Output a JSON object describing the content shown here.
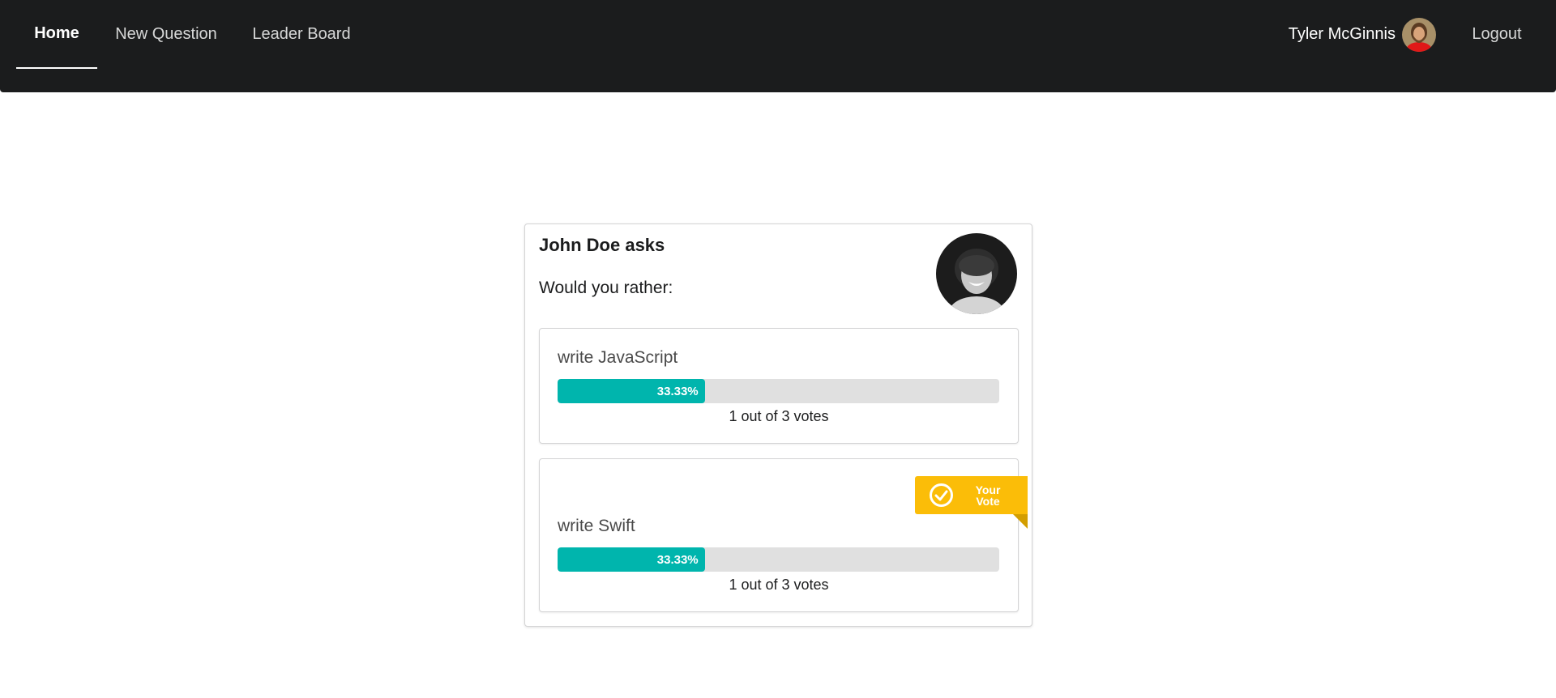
{
  "nav": {
    "home": "Home",
    "new_question": "New Question",
    "leader_board": "Leader Board",
    "user_name": "Tyler McGinnis",
    "logout": "Logout"
  },
  "poll": {
    "asker": "John Doe asks",
    "question": "Would you rather:",
    "options": [
      {
        "text": "write JavaScript",
        "percent": 33.33,
        "percent_label": "33.33%",
        "votes_label": "1 out of 3 votes",
        "your_vote": false
      },
      {
        "text": "write Swift",
        "percent": 33.33,
        "percent_label": "33.33%",
        "votes_label": "1 out of 3 votes",
        "your_vote": true
      }
    ],
    "your_vote_label": "Your Vote"
  },
  "colors": {
    "nav_bg": "#1b1c1d",
    "progress_fill": "#00b5ad",
    "progress_track": "#e0e0e0",
    "ribbon": "#fbbd08"
  },
  "icons": {
    "ribbon_icon": "check-circle-icon"
  }
}
